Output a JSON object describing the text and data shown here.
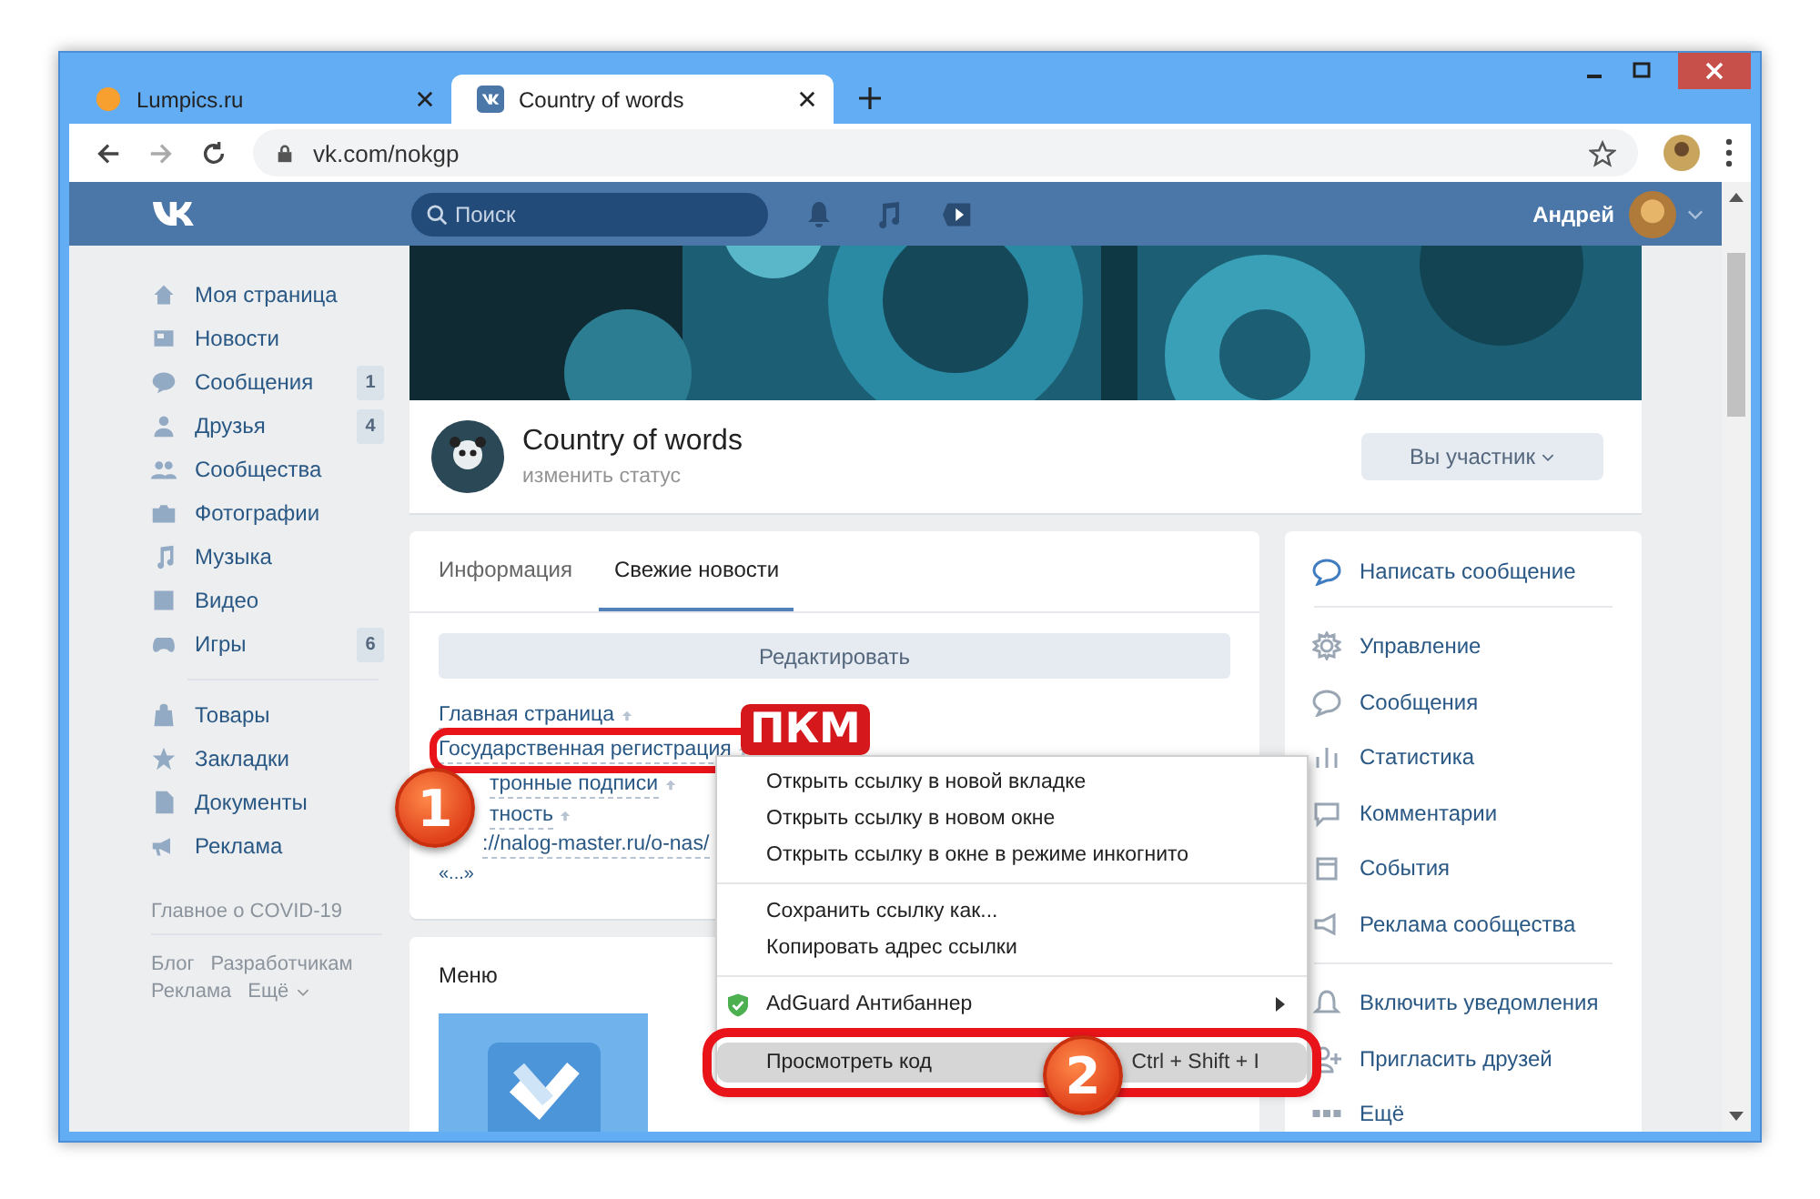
{
  "browser": {
    "tabs": [
      {
        "title": "Lumpics.ru",
        "selected": false
      },
      {
        "title": "Country of words",
        "selected": true
      }
    ],
    "address": "vk.com/nokgp"
  },
  "header": {
    "search_placeholder": "Поиск",
    "user_name": "Андрей"
  },
  "sidebar": {
    "main_items": [
      {
        "label": "Моя страница"
      },
      {
        "label": "Новости"
      },
      {
        "label": "Сообщения",
        "badge": "1"
      },
      {
        "label": "Друзья",
        "badge": "4"
      },
      {
        "label": "Сообщества"
      },
      {
        "label": "Фотографии"
      },
      {
        "label": "Музыка"
      },
      {
        "label": "Видео"
      },
      {
        "label": "Игры",
        "badge": "6"
      }
    ],
    "extra_items": [
      {
        "label": "Товары"
      },
      {
        "label": "Закладки"
      },
      {
        "label": "Документы"
      },
      {
        "label": "Реклама"
      }
    ],
    "note": "Главное о COVID-19",
    "footer_links": [
      "Блог",
      "Разработчикам",
      "Реклама",
      "Ещё"
    ]
  },
  "group": {
    "name": "Country of words",
    "status": "изменить статус",
    "member_button": "Вы участник"
  },
  "tabs": [
    {
      "label": "Информация",
      "selected": false
    },
    {
      "label": "Свежие новости",
      "selected": true
    }
  ],
  "edit_button": "Редактировать",
  "wiki_links": [
    {
      "text": "Главная страница",
      "kind": "page",
      "annotated": false
    },
    {
      "text": "Государственная регистрация",
      "kind": "page",
      "annotated": true
    },
    {
      "text": "тронные подписи",
      "kind": "page",
      "annotated": false
    },
    {
      "text": "тность",
      "kind": "page",
      "annotated": false
    },
    {
      "text": "://nalog-master.ru/o-nas/",
      "kind": "url",
      "annotated": false
    }
  ],
  "wiki_more": "«...»",
  "menu_block": {
    "title": "Меню"
  },
  "actions": [
    {
      "label": "Написать сообщение",
      "kind": "primary"
    },
    {
      "kind": "separator"
    },
    {
      "label": "Управление",
      "kind": "item"
    },
    {
      "label": "Сообщения",
      "kind": "item"
    },
    {
      "label": "Статистика",
      "kind": "item"
    },
    {
      "label": "Комментарии",
      "kind": "item"
    },
    {
      "label": "События",
      "kind": "item"
    },
    {
      "label": "Реклама сообщества",
      "kind": "item"
    },
    {
      "kind": "separator"
    },
    {
      "label": "Включить уведомления",
      "kind": "item"
    },
    {
      "label": "Пригласить друзей",
      "kind": "item"
    },
    {
      "label": "Ещё",
      "kind": "item"
    }
  ],
  "context_menu": [
    {
      "kind": "item",
      "label": "Открыть ссылку в новой вкладке",
      "selected": false,
      "annotated": false
    },
    {
      "kind": "item",
      "label": "Открыть ссылку в новом окне",
      "selected": false,
      "annotated": false
    },
    {
      "kind": "item",
      "label": "Открыть ссылку в окне в режиме инкогнито",
      "selected": false,
      "annotated": false
    },
    {
      "kind": "separator"
    },
    {
      "kind": "item",
      "label": "Сохранить ссылку как...",
      "selected": false,
      "annotated": false
    },
    {
      "kind": "item",
      "label": "Копировать адрес ссылки",
      "selected": false,
      "annotated": false
    },
    {
      "kind": "separator"
    },
    {
      "kind": "submenu",
      "label": "AdGuard Антибаннер",
      "selected": false,
      "annotated": false
    },
    {
      "kind": "separator"
    },
    {
      "kind": "item",
      "label": "Просмотреть код",
      "shortcut": "Ctrl + Shift + I",
      "selected": true,
      "annotated": true
    }
  ],
  "annotations": {
    "label": "ПКМ",
    "steps": [
      "1",
      "2"
    ]
  }
}
